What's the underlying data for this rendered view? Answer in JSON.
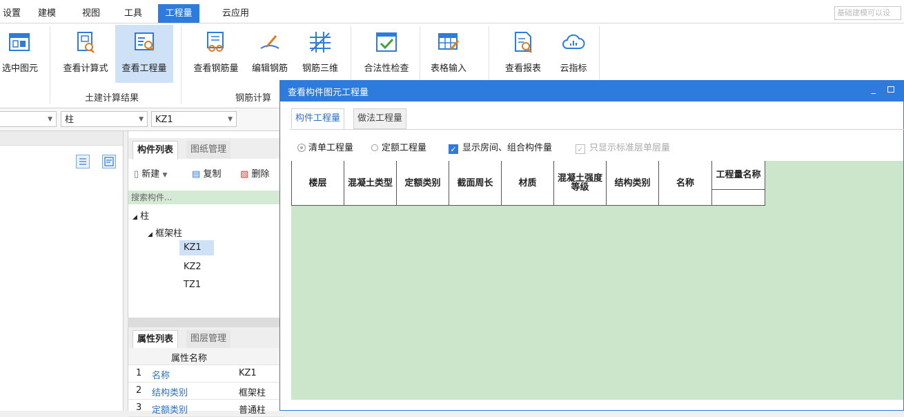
{
  "menubar": {
    "items": [
      "设置",
      "建模",
      "视图",
      "工具",
      "工程量",
      "云应用"
    ],
    "active_index": 4,
    "search_placeholder": "基础建模可以设"
  },
  "ribbon": {
    "buttons": [
      {
        "label": "选中图元",
        "icon": "select-element-icon"
      },
      {
        "label": "查看计算式",
        "icon": "view-formula-icon"
      },
      {
        "label": "查看工程量",
        "icon": "view-quantity-icon"
      },
      {
        "label": "查看钢筋量",
        "icon": "view-rebar-quantity-icon"
      },
      {
        "label": "编辑钢筋",
        "icon": "edit-rebar-icon"
      },
      {
        "label": "钢筋三维",
        "icon": "rebar-3d-icon"
      },
      {
        "label": "合法性检查",
        "icon": "validity-check-icon"
      },
      {
        "label": "表格输入",
        "icon": "table-input-icon"
      },
      {
        "label": "查看报表",
        "icon": "view-report-icon"
      },
      {
        "label": "云指标",
        "icon": "cloud-index-icon"
      }
    ],
    "groups": [
      "土建计算结果",
      "钢筋计算"
    ]
  },
  "filters": {
    "combo1": "",
    "combo2": "柱",
    "combo3": "KZ1"
  },
  "component_panel": {
    "tabs": [
      "构件列表",
      "图纸管理"
    ],
    "toolbar": {
      "new": "新建",
      "copy": "复制",
      "delete": "删除"
    },
    "search_placeholder": "搜索构件...",
    "tree": {
      "root": "柱",
      "child": "框架柱",
      "leaves": [
        "KZ1",
        "KZ2",
        "TZ1"
      ],
      "selected": "KZ1"
    }
  },
  "property_panel": {
    "tabs": [
      "属性列表",
      "图层管理"
    ],
    "header": "属性名称",
    "rows": [
      {
        "num": "1",
        "name": "名称",
        "value": "KZ1"
      },
      {
        "num": "2",
        "name": "结构类别",
        "value": "框架柱"
      },
      {
        "num": "3",
        "name": "定额类别",
        "value": "普通柱"
      }
    ]
  },
  "dialog": {
    "title": "查看构件图元工程量",
    "tabs": [
      "构件工程量",
      "做法工程量"
    ],
    "options": {
      "radio1": "清单工程量",
      "radio2": "定额工程量",
      "check1": "显示房间、组合构件量",
      "check2": "只显示标准层单层量"
    },
    "columns": [
      "楼层",
      "混凝土类型",
      "定额类别",
      "截面周长",
      "材质",
      "混凝土强度等级",
      "结构类别",
      "名称",
      "工程量名称"
    ]
  },
  "colors": {
    "accent": "#2d7bdc",
    "grid_bg": "#cce6cc",
    "ribbon_selected": "#cfe1f6"
  }
}
